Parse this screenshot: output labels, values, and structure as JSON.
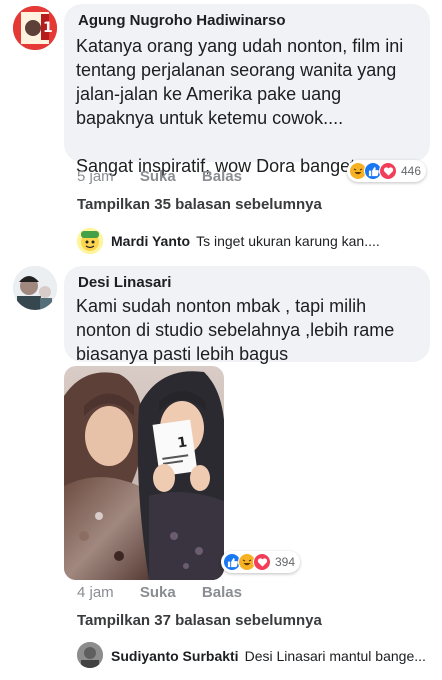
{
  "comments": [
    {
      "author": "Agung Nugroho Hadiwinarso",
      "text": "Katanya orang yang udah nonton, film ini tentang perjalanan seorang wanita yang jalan-jalan ke Amerika pake uang bapaknya untuk ketemu cowok....\n\nSangat inspiratif, wow Dora banget",
      "time": "5 jam",
      "like_label": "Suka",
      "reply_label": "Balas",
      "reaction_count": "446",
      "reactions": [
        "haha",
        "like",
        "love"
      ],
      "more_replies": "Tampilkan 35 balasan sebelumnya",
      "reply_preview": {
        "author": "Mardi Yanto",
        "text": "Ts inget ukuran karung kan...."
      }
    },
    {
      "author": "Desi Linasari",
      "text": "Kami sudah nonton mbak , tapi milih nonton di studio sebelahnya ,lebih rame  biasanya pasti lebih bagus",
      "time": "4 jam",
      "like_label": "Suka",
      "reply_label": "Balas",
      "reaction_count": "394",
      "reactions": [
        "like",
        "haha",
        "love"
      ],
      "more_replies": "Tampilkan 37 balasan sebelumnya",
      "reply_preview": {
        "author": "Sudiyanto Surbakti",
        "text": "Desi Linasari mantul bange..."
      }
    }
  ],
  "colors": {
    "bubble": "#f0f2f5",
    "like": "#1877f2",
    "love": "#f33e58",
    "haha": "#f7b125",
    "meta": "#8a8d91"
  }
}
